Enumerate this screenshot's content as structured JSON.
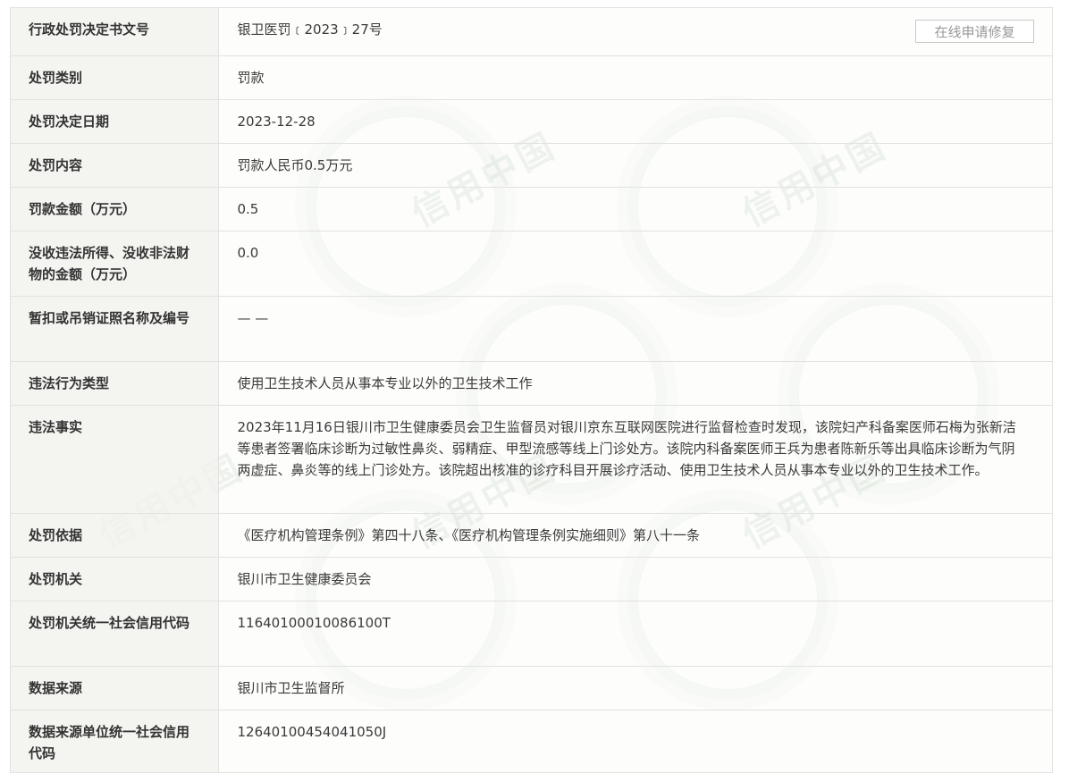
{
  "actions": {
    "repair_button_label": "在线申请修复"
  },
  "watermark": {
    "text": "信用中国"
  },
  "rows": [
    {
      "label": "行政处罚决定书文号",
      "value": "银卫医罚﹝2023﹞27号"
    },
    {
      "label": "处罚类别",
      "value": "罚款"
    },
    {
      "label": "处罚决定日期",
      "value": "2023-12-28"
    },
    {
      "label": "处罚内容",
      "value": "罚款人民币0.5万元"
    },
    {
      "label": "罚款金额（万元）",
      "value": "0.5"
    },
    {
      "label": "没收违法所得、没收非法财物的金额（万元）",
      "value": "0.0"
    },
    {
      "label": "暂扣或吊销证照名称及编号",
      "value": "— —"
    },
    {
      "label": "违法行为类型",
      "value": "使用卫生技术人员从事本专业以外的卫生技术工作"
    },
    {
      "label": "违法事实",
      "value": "2023年11月16日银川市卫生健康委员会卫生监督员对银川京东互联网医院进行监督检查时发现，该院妇产科备案医师石梅为张新洁等患者签署临床诊断为过敏性鼻炎、弱精症、甲型流感等线上门诊处方。该院内科备案医师王兵为患者陈新乐等出具临床诊断为气阴两虚症、鼻炎等的线上门诊处方。该院超出核准的诊疗科目开展诊疗活动、使用卫生技术人员从事本专业以外的卫生技术工作。"
    },
    {
      "label": "处罚依据",
      "value": "《医疗机构管理条例》第四十八条、《医疗机构管理条例实施细则》第八十一条"
    },
    {
      "label": "处罚机关",
      "value": "银川市卫生健康委员会"
    },
    {
      "label": "处罚机关统一社会信用代码",
      "value": "11640100010086100T"
    },
    {
      "label": "数据来源",
      "value": "银川市卫生监督所"
    },
    {
      "label": "数据来源单位统一社会信用代码",
      "value": "12640100454041050J"
    }
  ]
}
